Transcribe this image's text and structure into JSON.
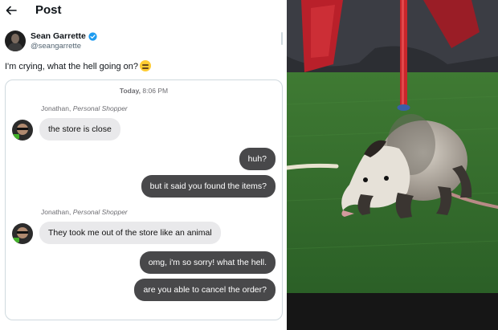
{
  "header": {
    "title": "Post"
  },
  "author": {
    "display_name": "Sean Garrette",
    "handle": "@seangarrette"
  },
  "tweet": {
    "text": "I'm crying, what the hell going on?"
  },
  "chat": {
    "timestamp_day": "Today,",
    "timestamp_time": "8:06 PM",
    "sender_name": "Jonathan,",
    "sender_role": "Personal Shopper",
    "messages": [
      {
        "from": "shopper",
        "text": "the store is close"
      },
      {
        "from": "me",
        "text": "huh?"
      },
      {
        "from": "me",
        "text": "but it said you found the items?"
      },
      {
        "from": "shopper",
        "text": "They took me out of the store like an animal"
      },
      {
        "from": "me",
        "text": "omg, i'm so sorry! what the hell."
      },
      {
        "from": "me",
        "text": "are you able to cancel the order?"
      }
    ]
  },
  "colors": {
    "verified": "#1d9bf0",
    "outgoing_bubble": "#48484a",
    "incoming_bubble": "#e9e9eb",
    "turf": "#2f6b2a",
    "pole": "#c9262b"
  },
  "icons": [
    "back-arrow-icon",
    "verified-badge-icon",
    "crying-emoji-icon"
  ]
}
